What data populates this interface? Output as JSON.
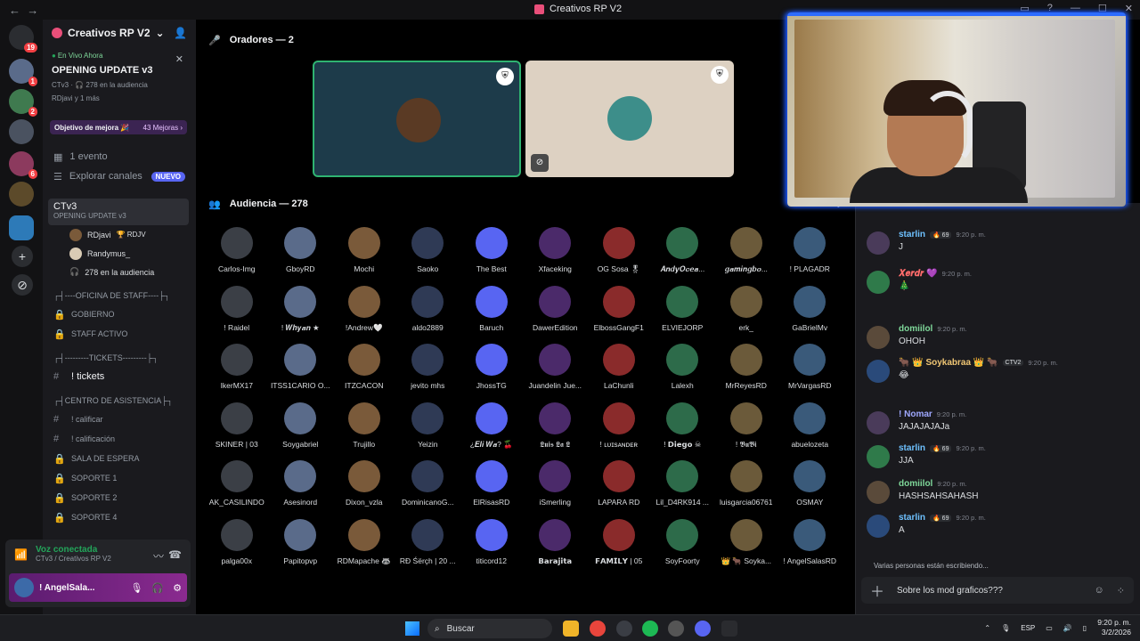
{
  "window": {
    "title": "Creativos RP V2"
  },
  "rail": {
    "badges": [
      "19",
      "1",
      "2",
      "6"
    ],
    "add_label": "+",
    "explore_label": "⊘"
  },
  "server": {
    "name": "Creativos RP V2",
    "live": {
      "tag": "En Vivo Ahora",
      "title": "OPENING UPDATE v3",
      "meta1": "CTv3 · 🎧 278 en la audiencia",
      "meta2": "RDjavi y 1 más"
    },
    "goal": {
      "label": "Objetivo de mejora 🎉",
      "count": "43 Mejoras ›"
    },
    "events": "1 evento",
    "explore": "Explorar canales",
    "nuevo": "NUEVO",
    "voice": {
      "name": "CTv3",
      "sub": "OPENING UPDATE v3",
      "users": [
        "RDjavi",
        "Randymus_"
      ],
      "user_tag": "🏆 RDJV",
      "audience": "278 en la audiencia"
    },
    "categories": [
      {
        "label": "┌┤----OFICINA DE STAFF----├┐",
        "channels": [
          "GOBIERNO",
          "STAFF ACTIVO"
        ]
      },
      {
        "label": "┌┤---------TICKETS---------├┐",
        "channels": [
          "! tickets"
        ]
      },
      {
        "label": "┌┤CENTRO DE ASISTENCIA├┐",
        "channels": [
          "! calificar",
          "! calificación",
          "SALA DE ESPERA",
          "SOPORTE 1",
          "SOPORTE 2",
          "SOPORTE 4"
        ]
      }
    ]
  },
  "userpanel": {
    "status": "Voz conectada",
    "channel": "CTv3 / Creativos RP V2",
    "username": "! AngelSala..."
  },
  "stage": {
    "speakers_header": "Oradores — 2",
    "audience_header": "Audiencia — 278",
    "audience": [
      "Carlos-Img",
      "GboyRD",
      "Mochi",
      "Saoko",
      "The Best",
      "Xfaceking",
      "OG Sosa 🎖",
      "𝑨𝒏𝒅𝒚𝑶𝒄𝒆𝒂...",
      "𝒈𝒂𝒎𝒊𝒏𝒈𝒃𝒐...",
      "! PLAGADR",
      "! Raidel",
      "! 𝑾𝒉𝒚𝒂𝒏 ★",
      "!Andrew🤍",
      "aldo2889",
      "Baruch",
      "DawerEdition",
      "ElbossGangF1",
      "ELVIEJORP",
      "erk_",
      "GaBrielMv",
      "IkerMX17",
      "ITSS1CARIO O...",
      "ITZCACON",
      "jevito mhs",
      "JhossTG",
      "Juandelin Jue...",
      "LaChunli",
      "Lalexh",
      "MrReyesRD",
      "MrVargasRD",
      "SKINER | 03",
      "Soygabriel",
      "Trujillo",
      "Yeizin",
      "¿𝑬𝒍𝒊 𝑾𝒂? 🍒",
      "𝕷𝖚𝖎𝖘 𝕷𝖆 𝕷",
      "! ʟᴜɪsᴀɴᴅᴇʀ",
      "! 𝗗𝗶𝗲𝗴𝗼 ☠",
      "! 𝕭𝖚𝕭𝖎",
      "abuelozeta",
      "AK_CASILINDO",
      "Asesinord",
      "Dixon_vzla",
      "DominicanoG...",
      "ElRisasRD",
      "iSmerling",
      "LAPARA RD",
      "Lil_D4RK914 ...",
      "luisgarcia06761",
      "OSMAY",
      "palga00x",
      "Papitopvp",
      "RDMapache 🦝",
      "RĐ Śërçh | 20 ...",
      "titicord12",
      "𝗕𝗮𝗿𝗮𝗷𝗶𝘁𝗮",
      "𝗙𝗔𝗠𝗜𝗟𝗬 | 05",
      "SoyFoorty",
      "👑 🐂 Soyka...",
      "! AngelSalasRD"
    ]
  },
  "chat": {
    "messages": [
      {
        "author": "starlin",
        "badge": "🔥 69",
        "time": "9:20 p. m.",
        "text": "J",
        "color": "#6ec1ff"
      },
      {
        "author": "𝑿𝒆𝒓𝒅𝒓 💜",
        "badge": "",
        "time": "9:20 p. m.",
        "text": "🎄",
        "color": "#ff6b6b"
      },
      {
        "author": "domiilol",
        "badge": "",
        "time": "9:20 p. m.",
        "text": "OHOH",
        "color": "#7fd89a"
      },
      {
        "author": "🐂 👑 Soykabraa 👑 🐂",
        "badge": "CTV2",
        "time": "9:20 p. m.",
        "text": "😂",
        "color": "#f0c674"
      },
      {
        "author": "! Nomar",
        "badge": "",
        "time": "9:20 p. m.",
        "text": "JAJAJAJAJa",
        "color": "#9fa8ff"
      },
      {
        "author": "starlin",
        "badge": "🔥 69",
        "time": "9:20 p. m.",
        "text": "JJA",
        "color": "#6ec1ff"
      },
      {
        "author": "domiilol",
        "badge": "",
        "time": "9:20 p. m.",
        "text": "HASHSAHSAHASH",
        "color": "#7fd89a"
      },
      {
        "author": "starlin",
        "badge": "🔥 69",
        "time": "9:20 p. m.",
        "text": "A",
        "color": "#6ec1ff"
      }
    ],
    "typing": "Varias personas están escribiendo...",
    "composer_value": "Sobre los mod graficos???"
  },
  "taskbar": {
    "search": "Buscar",
    "lang": "ESP",
    "time": "9:20 p. m.",
    "date": "3/2/2026"
  }
}
